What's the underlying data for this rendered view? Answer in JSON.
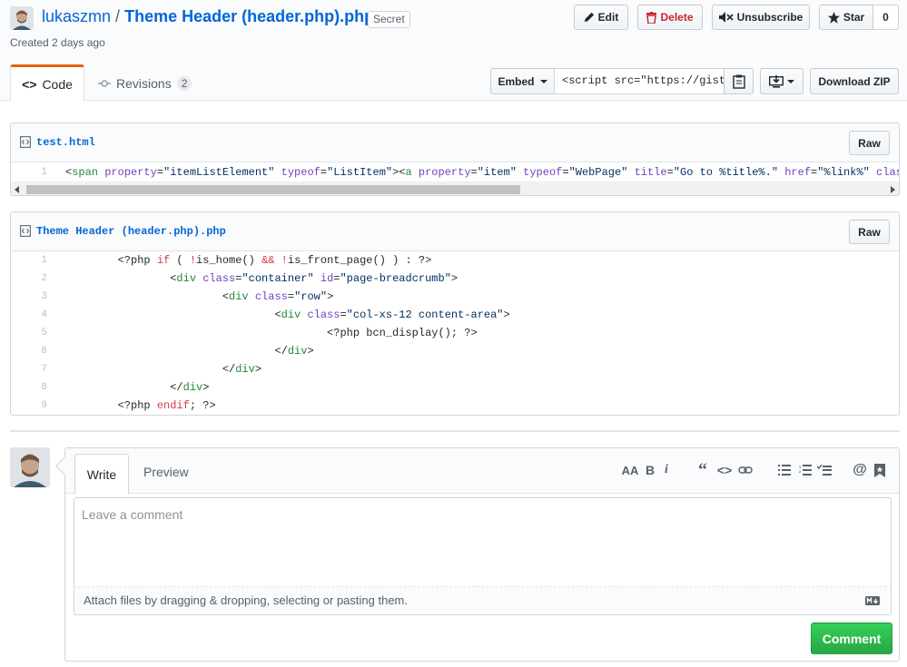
{
  "header": {
    "owner": "lukaszmn",
    "separator": "/",
    "gist_name": "Theme Header (header.php).php",
    "secret_label": "Secret",
    "created": "Created 2 days ago",
    "edit_label": "Edit",
    "delete_label": "Delete",
    "unsubscribe_label": "Unsubscribe",
    "star_label": "Star",
    "star_count": "0"
  },
  "tabs": {
    "code_label": "Code",
    "revisions_label": "Revisions",
    "revisions_count": "2"
  },
  "toolbar": {
    "embed_label": "Embed",
    "embed_value": "<script src=\"https://gist.",
    "download_zip_label": "Download ZIP"
  },
  "files": [
    {
      "name": "test.html",
      "raw_label": "Raw",
      "lines": [
        {
          "num": "1",
          "text": "<span property=\"itemListElement\" typeof=\"ListItem\"><a property=\"item\" typeof=\"WebPage\" title=\"Go to %title%.\" href=\"%link%\" class=\"%type%\" "
        }
      ]
    },
    {
      "name": "Theme Header (header.php).php",
      "raw_label": "Raw",
      "lines": [
        {
          "num": "1",
          "text": "        <?php if ( !is_home() && !is_front_page() ) : ?>"
        },
        {
          "num": "2",
          "text": "                <div class=\"container\" id=\"page-breadcrumb\">"
        },
        {
          "num": "3",
          "text": "                        <div class=\"row\">"
        },
        {
          "num": "4",
          "text": "                                <div class=\"col-xs-12 content-area\">"
        },
        {
          "num": "5",
          "text": "                                        <?php bcn_display(); ?>"
        },
        {
          "num": "6",
          "text": "                                </div>"
        },
        {
          "num": "7",
          "text": "                        </div>"
        },
        {
          "num": "8",
          "text": "                </div>"
        },
        {
          "num": "9",
          "text": "        <?php endif; ?>"
        }
      ]
    }
  ],
  "comment": {
    "write_tab": "Write",
    "preview_tab": "Preview",
    "placeholder": "Leave a comment",
    "attach_text": "Attach files by dragging & dropping, selecting or pasting them.",
    "submit_label": "Comment",
    "tools": [
      "text-size-icon",
      "bold-icon",
      "italic-icon",
      "quote-icon",
      "code-icon",
      "link-icon",
      "bulleted-list-icon",
      "numbered-list-icon",
      "task-list-icon",
      "mention-icon",
      "saved-reply-icon"
    ]
  },
  "colors": {
    "link": "#0366d6",
    "danger": "#cb2431",
    "accent_tab": "#e36209",
    "primary_button": "#28a745"
  }
}
